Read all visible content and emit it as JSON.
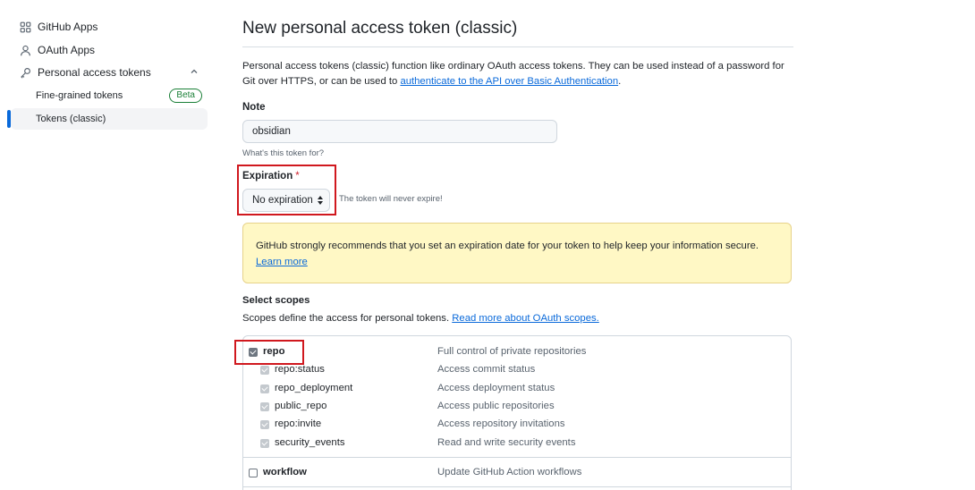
{
  "sidebar": {
    "items": [
      {
        "label": "GitHub Apps",
        "icon": "apps-grid-icon"
      },
      {
        "label": "OAuth Apps",
        "icon": "person-icon"
      },
      {
        "label": "Personal access tokens",
        "icon": "key-icon"
      }
    ],
    "subitems": [
      {
        "label": "Fine-grained tokens",
        "badge": "Beta"
      },
      {
        "label": "Tokens (classic)"
      }
    ]
  },
  "page": {
    "title": "New personal access token (classic)",
    "intro_text": "Personal access tokens (classic) function like ordinary OAuth access tokens. They can be used instead of a password for Git over HTTPS, or can be used to ",
    "intro_link": "authenticate to the API over Basic Authentication",
    "intro_end": "."
  },
  "note": {
    "label": "Note",
    "value": "obsidian",
    "hint": "What's this token for?"
  },
  "expiration": {
    "label": "Expiration",
    "required_mark": "*",
    "selected": "No expiration",
    "hint": "The token will never expire!"
  },
  "flash": {
    "text": "GitHub strongly recommends that you set an expiration date for your token to help keep your information secure.",
    "link": "Learn more"
  },
  "scopes": {
    "label": "Select scopes",
    "desc": "Scopes define the access for personal tokens.",
    "desc_link": "Read more about OAuth scopes.",
    "groups": [
      {
        "name": "repo",
        "desc": "Full control of private repositories",
        "checked": true,
        "children": [
          {
            "name": "repo:status",
            "desc": "Access commit status"
          },
          {
            "name": "repo_deployment",
            "desc": "Access deployment status"
          },
          {
            "name": "public_repo",
            "desc": "Access public repositories"
          },
          {
            "name": "repo:invite",
            "desc": "Access repository invitations"
          },
          {
            "name": "security_events",
            "desc": "Read and write security events"
          }
        ]
      },
      {
        "name": "workflow",
        "desc": "Update GitHub Action workflows",
        "checked": false,
        "children": []
      }
    ]
  },
  "colors": {
    "accent": "#0969da",
    "highlight_box": "#d0181e",
    "flash_bg": "#fff8c5",
    "beta_badge": "#1a7f37"
  }
}
